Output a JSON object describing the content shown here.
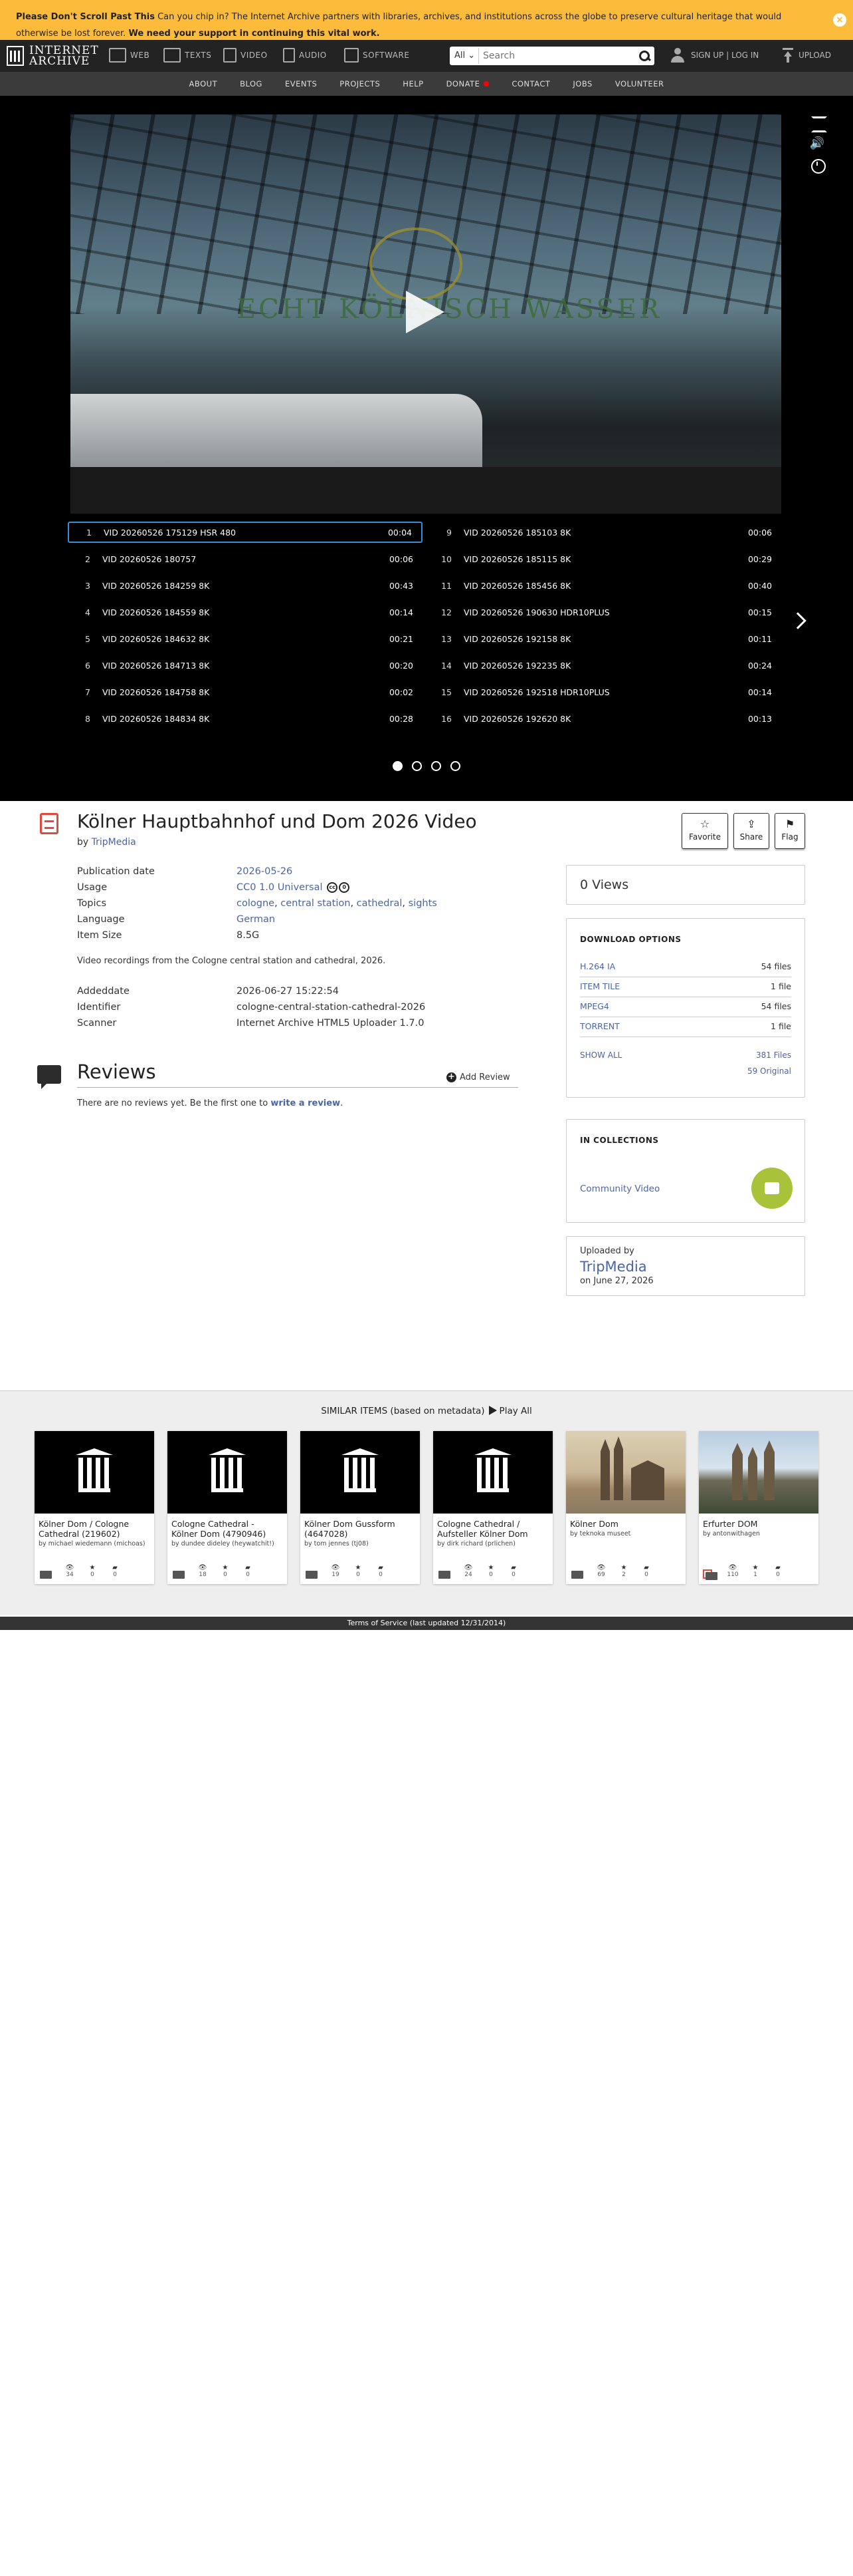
{
  "banner": {
    "lead": "Please Don't Scroll Past This",
    "text": " Can you chip in? The Internet Archive partners with libraries, archives, and institutions across the globe to preserve cultural heritage that would otherwise be lost forever. ",
    "emph": "We need your support in continuing this vital work.",
    "close": "×"
  },
  "nav": {
    "logo_line1": "INTERNET",
    "logo_line2": "ARCHIVE",
    "web": "WEB",
    "texts": "TEXTS",
    "video": "VIDEO",
    "audio": "AUDIO",
    "software": "SOFTWARE",
    "search_scope": "All",
    "search_placeholder": "Search",
    "signup": "SIGN UP | LOG IN",
    "upload": "UPLOAD"
  },
  "subnav": [
    "ABOUT",
    "BLOG",
    "EVENTS",
    "PROJECTS",
    "HELP",
    "DONATE",
    "CONTACT",
    "JOBS",
    "VOLUNTEER"
  ],
  "video": {
    "sign_text": "ECHT KÖLNISCH WASSER",
    "volume_glyph": "🔊",
    "playlist": [
      {
        "num": "1",
        "title": "VID 20260526 175129 HSR 480",
        "dur": "00:04",
        "active": true
      },
      {
        "num": "2",
        "title": "VID 20260526 180757",
        "dur": "00:06"
      },
      {
        "num": "3",
        "title": "VID 20260526 184259 8K",
        "dur": "00:43"
      },
      {
        "num": "4",
        "title": "VID 20260526 184559 8K",
        "dur": "00:14"
      },
      {
        "num": "5",
        "title": "VID 20260526 184632 8K",
        "dur": "00:21"
      },
      {
        "num": "6",
        "title": "VID 20260526 184713 8K",
        "dur": "00:20"
      },
      {
        "num": "7",
        "title": "VID 20260526 184758 8K",
        "dur": "00:02"
      },
      {
        "num": "8",
        "title": "VID 20260526 184834 8K",
        "dur": "00:28"
      },
      {
        "num": "9",
        "title": "VID 20260526 185103 8K",
        "dur": "00:06"
      },
      {
        "num": "10",
        "title": "VID 20260526 185115 8K",
        "dur": "00:29"
      },
      {
        "num": "11",
        "title": "VID 20260526 185456 8K",
        "dur": "00:40"
      },
      {
        "num": "12",
        "title": "VID 20260526 190630 HDR10PLUS",
        "dur": "00:15"
      },
      {
        "num": "13",
        "title": "VID 20260526 192158 8K",
        "dur": "00:11"
      },
      {
        "num": "14",
        "title": "VID 20260526 192235 8K",
        "dur": "00:24"
      },
      {
        "num": "15",
        "title": "VID 20260526 192518 HDR10PLUS",
        "dur": "00:14"
      },
      {
        "num": "16",
        "title": "VID 20260526 192620 8K",
        "dur": "00:13"
      }
    ]
  },
  "item": {
    "title": "Kölner Hauptbahnhof und Dom 2026 Video",
    "by_label": "by ",
    "by": "TripMedia",
    "actions": {
      "favorite": "Favorite",
      "share": "Share",
      "flag": "Flag"
    },
    "meta": {
      "pubdate_k": "Publication date",
      "pubdate_v": "2026-05-26",
      "usage_k": "Usage",
      "usage_v": "CC0 1.0 Universal",
      "topics_k": "Topics",
      "topics": [
        "cologne",
        "central station",
        "cathedral",
        "sights"
      ],
      "language_k": "Language",
      "language_v": "German",
      "size_k": "Item Size",
      "size_v": "8.5G"
    },
    "description": "Video recordings from the Cologne central station and cathedral, 2026.",
    "meta2": {
      "added_k": "Addeddate",
      "added_v": "2026-06-27 15:22:54",
      "id_k": "Identifier",
      "id_v": "cologne-central-station-cathedral-2026",
      "scanner_k": "Scanner",
      "scanner_v": "Internet Archive HTML5 Uploader 1.7.0"
    }
  },
  "reviews": {
    "title": "Reviews",
    "add": "Add Review",
    "empty": "There are no reviews yet. Be the first one to ",
    "link": "write a review",
    "end": "."
  },
  "sidebar": {
    "views": "0 Views",
    "download_head": "DOWNLOAD OPTIONS",
    "downloads": [
      {
        "name": "H.264 IA",
        "count": "54 files"
      },
      {
        "name": "ITEM TILE",
        "count": "1 file"
      },
      {
        "name": "MPEG4",
        "count": "54 files"
      },
      {
        "name": "TORRENT",
        "count": "1 file"
      }
    ],
    "show_all": "SHOW ALL",
    "files": "381 Files",
    "original": "59 Original",
    "collections_head": "IN COLLECTIONS",
    "collection": "Community Video",
    "uploaded_by": "Uploaded by",
    "uploader": "TripMedia",
    "uploaded_on": "on June 27, 2026"
  },
  "similar": {
    "head": "SIMILAR ITEMS (based on metadata)",
    "play_all": "Play All",
    "cards": [
      {
        "title": "Kölner Dom / Cologne Cathedral (219602)",
        "by": "by michael wiedemann (michoas)",
        "views": "34",
        "favs": "0",
        "reviews": "0"
      },
      {
        "title": "Cologne Cathedral - Kölner Dom (4790946)",
        "by": "by dundee dideley (heywatchit!)",
        "views": "18",
        "favs": "0",
        "reviews": "0"
      },
      {
        "title": "Kölner Dom Gussform (4647028)",
        "by": "by tom jennes (tj08)",
        "views": "19",
        "favs": "0",
        "reviews": "0"
      },
      {
        "title": "Cologne Cathedral / Aufsteller Kölner Dom",
        "by": "by dirk richard (prlichen)",
        "views": "24",
        "favs": "0",
        "reviews": "0"
      },
      {
        "title": "Kölner Dom",
        "by": "by teknoka museet",
        "views": "69",
        "favs": "2",
        "reviews": "0"
      },
      {
        "title": "Erfurter DOM",
        "by": "by antonwithagen",
        "views": "110",
        "favs": "1",
        "reviews": "0"
      }
    ]
  },
  "footer": "Terms of Service (last updated 12/31/2014)"
}
